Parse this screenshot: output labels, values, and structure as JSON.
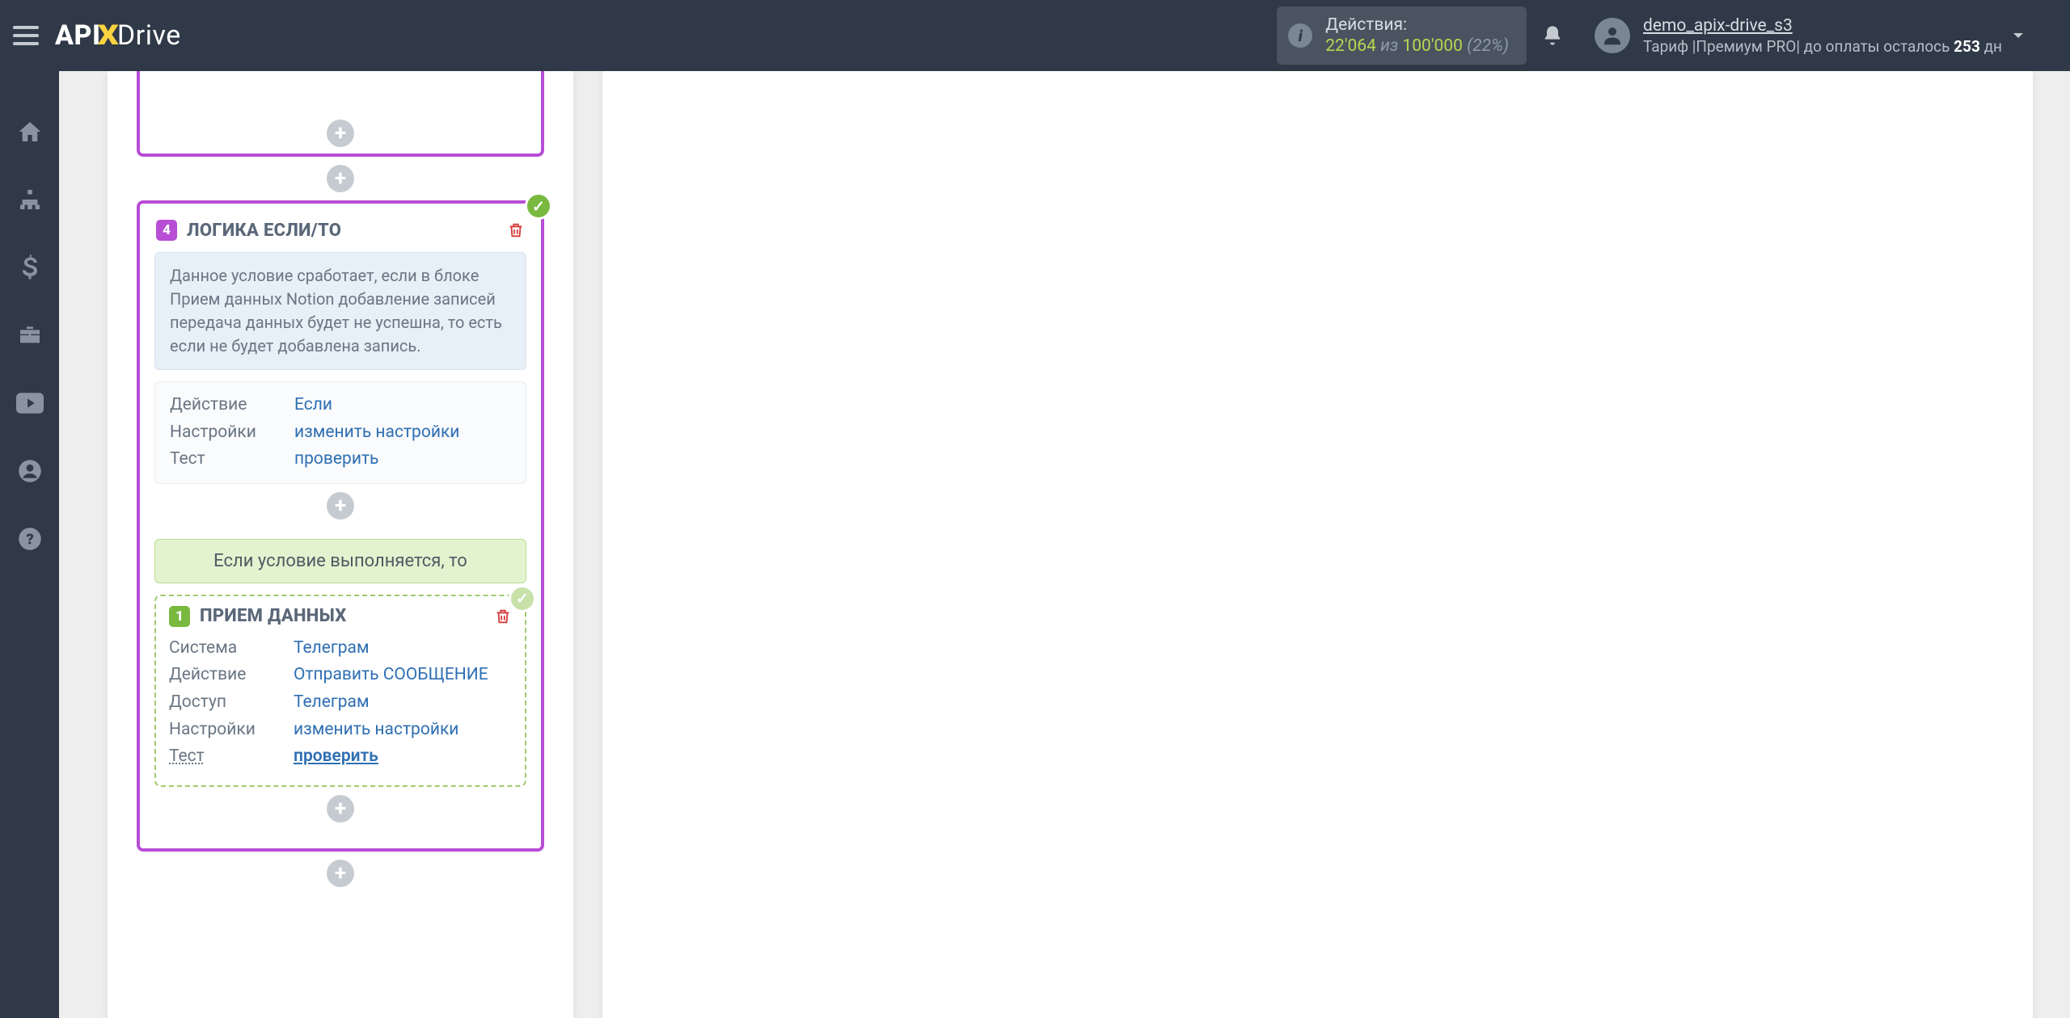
{
  "header": {
    "logo": {
      "part1": "API",
      "part2": "X",
      "part3": "Drive"
    },
    "actions": {
      "title": "Действия:",
      "count": "22'064",
      "of_word": "из",
      "total": "100'000",
      "pct": "(22%)"
    },
    "user": {
      "name": "demo_apix-drive_s3",
      "tariff_prefix": "Тариф |Премиум PRO| до оплаты осталось ",
      "days": "253",
      "days_suffix": " дн"
    }
  },
  "logic_block": {
    "num": "4",
    "title": "ЛОГИКА ЕСЛИ/ТО",
    "description": "Данное условие сработает, если в блоке Прием данных Notion добавление записей передача данных будет не успешна, то есть если не будет добавлена запись.",
    "rows": {
      "action_label": "Действие",
      "action_value": "Если",
      "settings_label": "Настройки",
      "settings_value": "изменить настройки",
      "test_label": "Тест",
      "test_value": "проверить"
    },
    "cond_banner": "Если условие выполняется, то"
  },
  "inner_block": {
    "num": "1",
    "title": "ПРИЕМ ДАННЫХ",
    "rows": {
      "system_label": "Система",
      "system_value": "Телеграм",
      "action_label": "Действие",
      "action_value": "Отправить СООБЩЕНИЕ",
      "access_label": "Доступ",
      "access_value": "Телеграм",
      "settings_label": "Настройки",
      "settings_value": "изменить настройки",
      "test_label": "Тест",
      "test_value": "проверить"
    }
  }
}
